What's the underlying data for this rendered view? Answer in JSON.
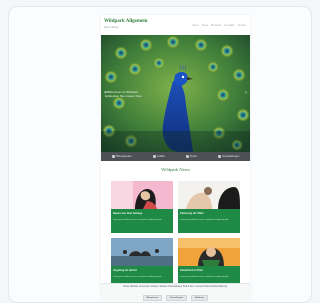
{
  "site": {
    "logo": "Wildpark Allgemein",
    "tagline": "Natur erleben",
    "nav": [
      "Start",
      "Tiere",
      "Besuch",
      "Kontakt",
      "Suche"
    ]
  },
  "hero": {
    "heading_line1": "Willkommen im Wildpark",
    "heading_line2": "Entdecken Sie unsere Tiere"
  },
  "subnav": [
    {
      "label": "Öffnungszeiten",
      "icon": "clock-icon"
    },
    {
      "label": "Anfahrt",
      "icon": "map-pin-icon"
    },
    {
      "label": "Preise",
      "icon": "ticket-icon"
    },
    {
      "label": "Veranstaltungen",
      "icon": "calendar-icon"
    }
  ],
  "section": {
    "title": "Wildpark News"
  },
  "tiles": [
    {
      "caption": "Neues aus dem Gehege",
      "meta": "Lorem ipsum dolor sit amet, consetetur sadipscing elitr."
    },
    {
      "caption": "Fütterung der Otter",
      "meta": "Lorem ipsum dolor sit amet, consetetur sadipscing elitr."
    },
    {
      "caption": "Vogelzug im Herbst",
      "meta": "Lorem ipsum dolor sit amet, consetetur sadipscing elitr."
    },
    {
      "caption": "Kinderfest im Park",
      "meta": "Lorem ipsum dolor sit amet, consetetur sadipscing elitr."
    }
  ],
  "cookie": {
    "text": "Diese Website verwendet Cookies. Weitere Informationen finden Sie in unserer Datenschutzerklärung.",
    "accept_label": "Akzeptieren",
    "settings_label": "Einstellungen",
    "decline_label": "Ablehnen"
  }
}
